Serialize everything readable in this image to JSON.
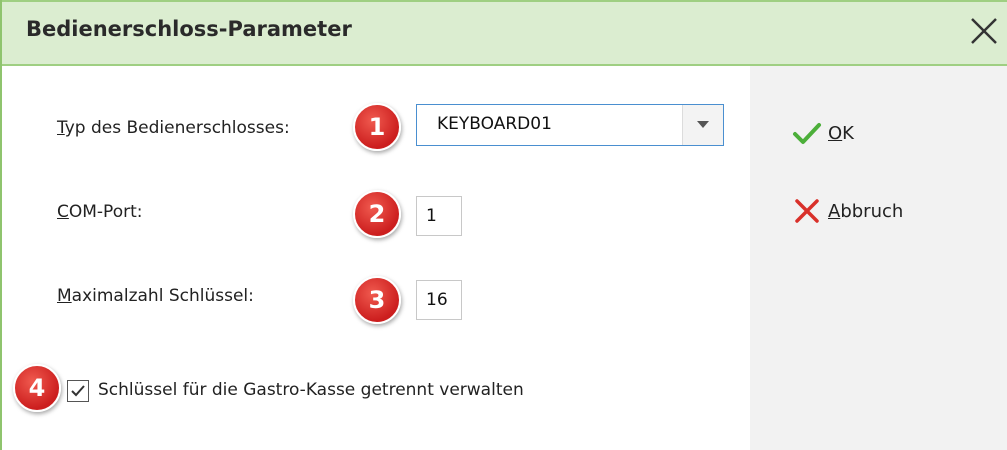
{
  "dialog": {
    "title": "Bedienerschloss-Parameter",
    "close_icon": "close-icon"
  },
  "fields": {
    "typ": {
      "label_first": "T",
      "label_rest": "yp des Bedienerschlosses:",
      "value": "KEYBOARD01",
      "badge": "1"
    },
    "com_port": {
      "label_first": "C",
      "label_rest": "OM-Port:",
      "value": "1",
      "badge": "2"
    },
    "max_keys": {
      "label_first": "M",
      "label_rest": "aximalzahl Schlüssel:",
      "value": "16",
      "badge": "3"
    },
    "separate": {
      "label": "Schlüssel für die Gastro-Kasse getrennt verwalten",
      "checked": true,
      "badge": "4"
    }
  },
  "buttons": {
    "ok_first": "O",
    "ok_rest": "K",
    "cancel_first": "A",
    "cancel_rest": "bbruch"
  },
  "colors": {
    "title_bg": "#dbedd0",
    "accent_green": "#8fc46e",
    "badge_red": "#cc1e1e",
    "ok_green": "#4caf3a",
    "cancel_red": "#d9302a"
  }
}
